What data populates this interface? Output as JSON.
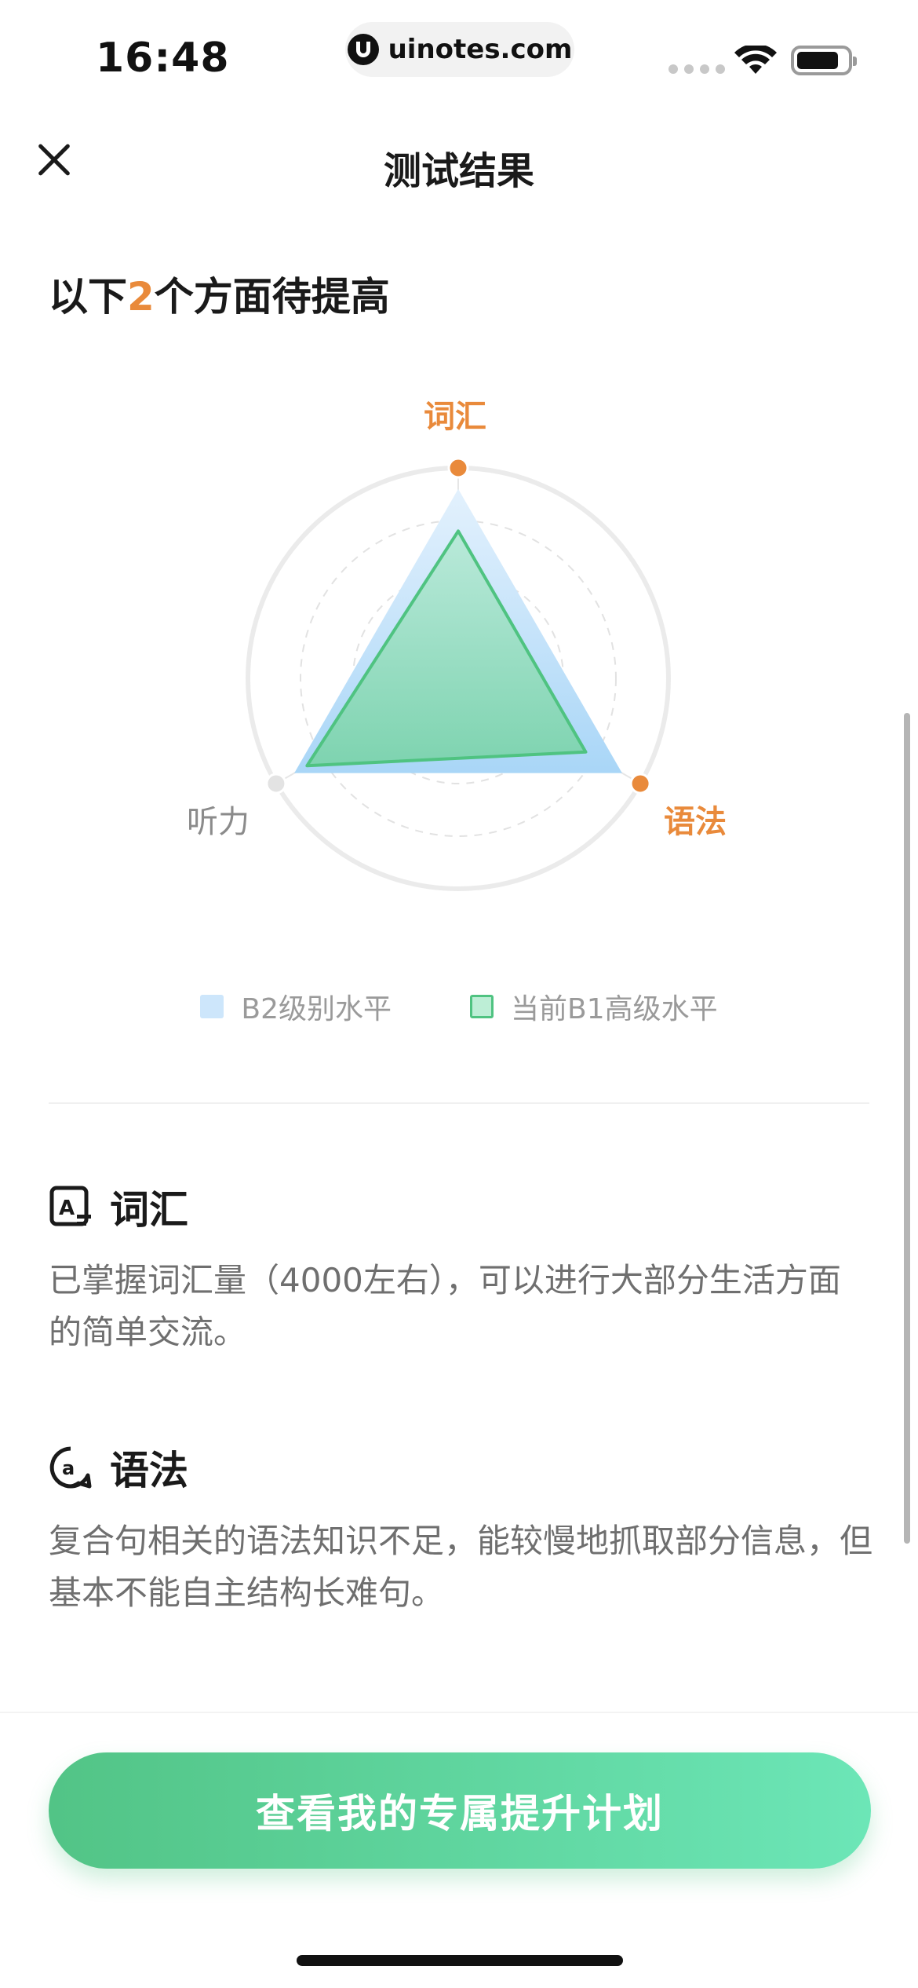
{
  "status_bar": {
    "time": "16:48",
    "url": "uinotes.com",
    "icons": [
      "signal-icon",
      "wifi-icon",
      "battery-icon"
    ]
  },
  "header": {
    "title": "测试结果",
    "close_icon": "close-icon"
  },
  "summary": {
    "prefix": "以下",
    "count": "2",
    "suffix": "个方面待提高"
  },
  "chart_data": {
    "type": "radar",
    "axes": [
      "词汇",
      "语法",
      "听力"
    ],
    "axis_colors": {
      "词汇": "#e98a3b",
      "语法": "#e98a3b",
      "听力": "#8b8b8b"
    },
    "range": [
      0,
      1
    ],
    "grid": true,
    "series": [
      {
        "name": "B2级别水平",
        "values": [
          0.9,
          0.9,
          0.9
        ],
        "color": "#cde6fb"
      },
      {
        "name": "当前B1高级水平",
        "values": [
          0.7,
          0.7,
          0.83
        ],
        "color": "#4fc381"
      }
    ],
    "legend_position": "bottom"
  },
  "sections": [
    {
      "icon": "vocabulary-card-icon",
      "title": "词汇",
      "text": "已掌握词汇量（4000左右），可以进行大部分生活方面的简单交流。"
    },
    {
      "icon": "grammar-at-icon",
      "title": "语法",
      "text": "复合句相关的语法知识不足，能较慢地抓取部分信息，但基本不能自主结构长难句。"
    }
  ],
  "cta": {
    "label": "查看我的专属提升计划"
  },
  "colors": {
    "accent_orange": "#e98a3b",
    "accent_green": "#52c486",
    "b2_blue": "#cde6fb"
  }
}
